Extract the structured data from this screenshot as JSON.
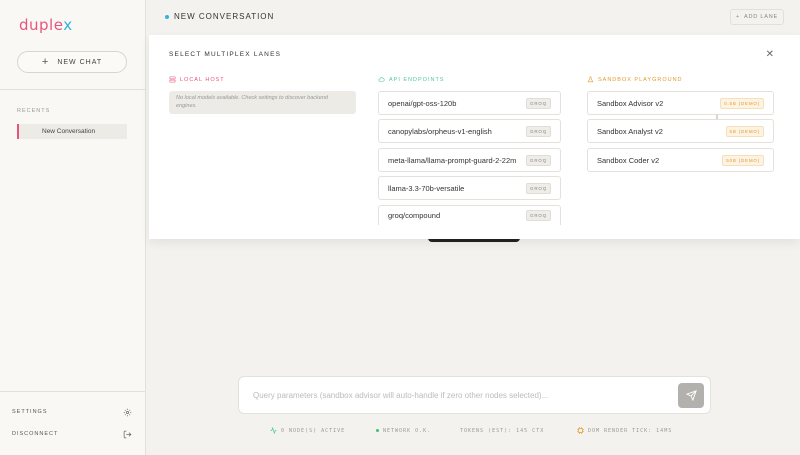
{
  "app": {
    "logo_prefix": "duple",
    "logo_suffix": "x"
  },
  "sidebar": {
    "new_chat_label": "NEW CHAT",
    "recents_label": "RECENTS",
    "recents": [
      {
        "label": "New Conversation",
        "active": true
      }
    ],
    "settings_label": "SETTINGS",
    "disconnect_label": "DISCONNECT"
  },
  "header": {
    "title": "NEW CONVERSATION",
    "add_lane_label": "ADD LANE"
  },
  "modal": {
    "title": "SELECT MULTIPLEX LANES",
    "local_host": {
      "heading": "LOCAL HOST",
      "empty_message": "No local models available. Check settings to discover backend engines."
    },
    "api_endpoints": {
      "heading": "API ENDPOINTS",
      "items": [
        {
          "name": "openai/gpt-oss-120b",
          "tag": "GROQ"
        },
        {
          "name": "canopylabs/orpheus-v1-english",
          "tag": "GROQ"
        },
        {
          "name": "meta-llama/llama-prompt-guard-2-22m",
          "tag": "GROQ"
        },
        {
          "name": "llama-3.3-70b-versatile",
          "tag": "GROQ"
        },
        {
          "name": "groq/compound",
          "tag": "GROQ"
        }
      ]
    },
    "sandbox": {
      "heading": "SANDBOX PLAYGROUND",
      "items": [
        {
          "name": "Sandbox Advisor v2",
          "tag": "0.5B (DEMO)"
        },
        {
          "name": "Sandbox Analyst v2",
          "tag": "5B (DEMO)"
        },
        {
          "name": "Sandbox Coder v2",
          "tag": "50B (DEMO)"
        }
      ]
    }
  },
  "query": {
    "placeholder": "Query parameters (sandbox advisor will auto-handle if zero other nodes selected)..."
  },
  "status": {
    "nodes": "0 NODE(S) ACTIVE",
    "network": "NETWORK O.K.",
    "tokens": "TOKENS (EST): 145 CTX",
    "render": "DOM RENDER TICK: 14MS"
  },
  "colors": {
    "brand_pink": "#e8557b",
    "brand_cyan": "#2fb5d8",
    "api_green": "#52c7a0",
    "sandbox_orange": "#e39a2f",
    "status_green": "#3bbf77"
  }
}
